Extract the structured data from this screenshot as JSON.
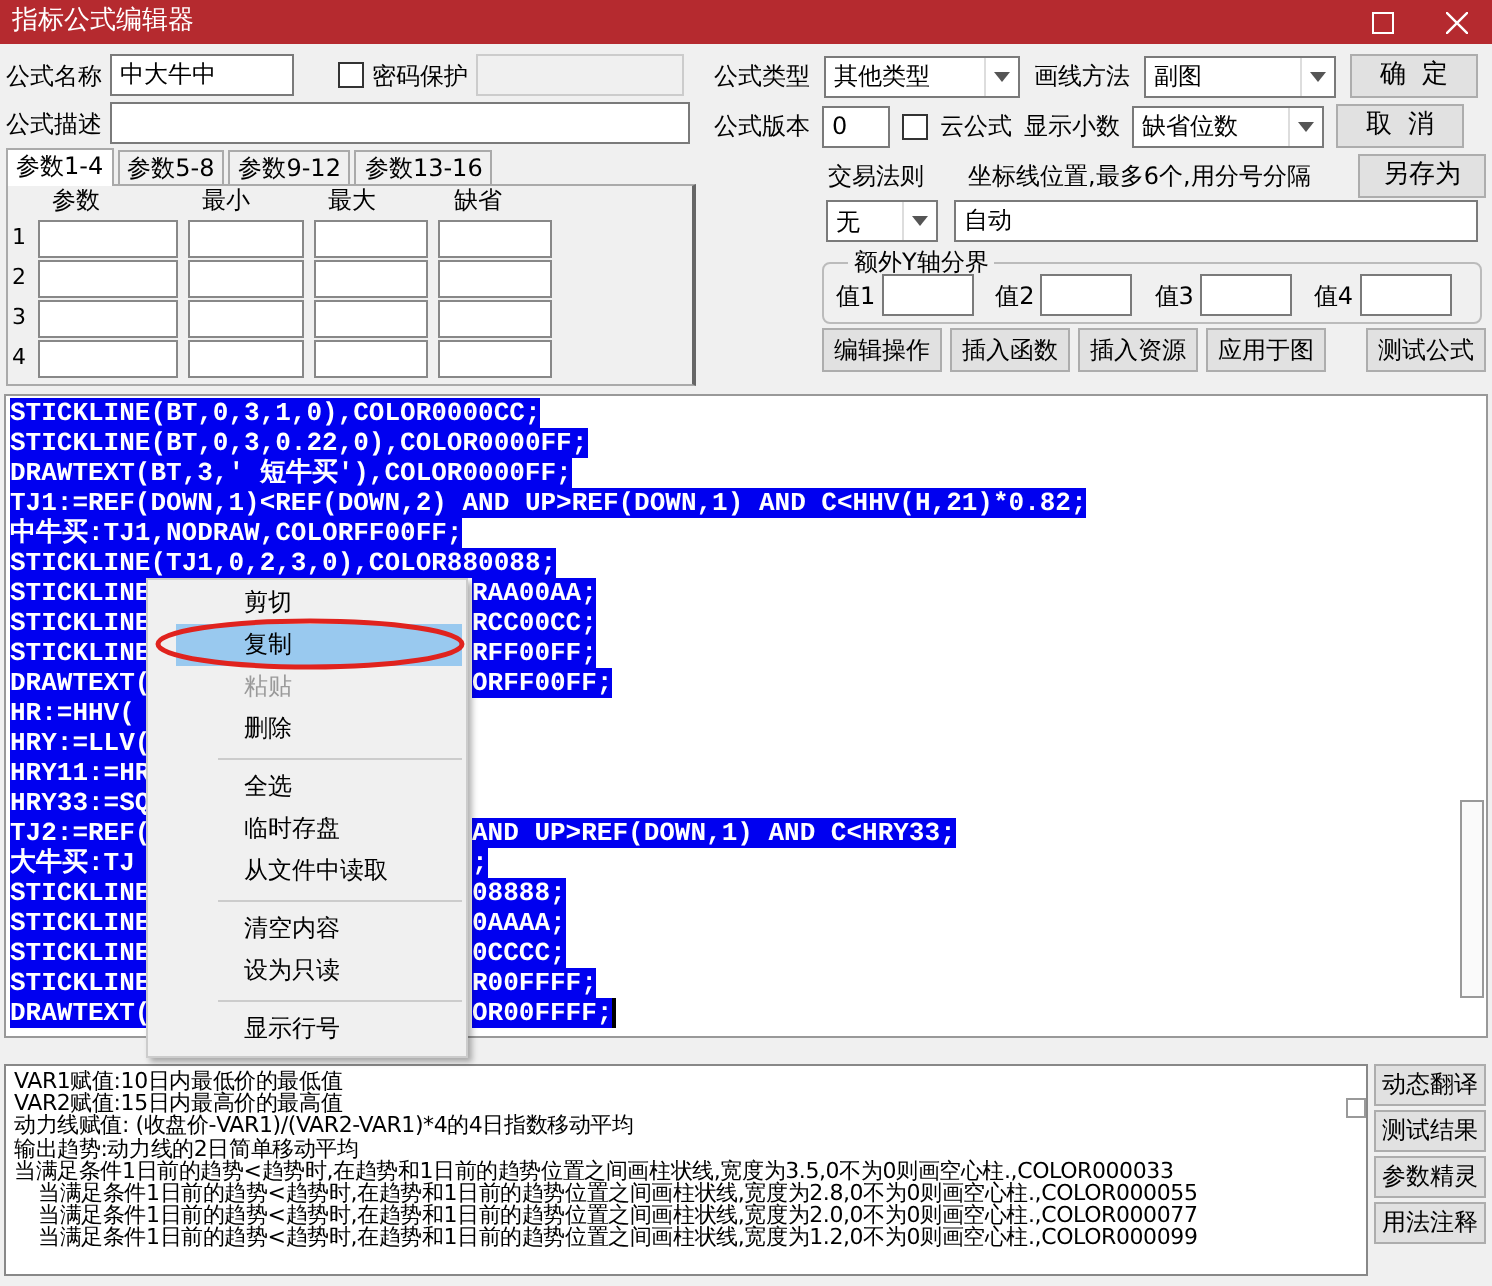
{
  "window": {
    "title": "指标公式编辑器"
  },
  "form": {
    "name": {
      "label": "公式名称",
      "value": "中大牛中"
    },
    "password": {
      "label": "密码保护",
      "checked": false
    },
    "description": {
      "label": "公式描述"
    },
    "type": {
      "label": "公式类型",
      "value": "其他类型"
    },
    "draw_method": {
      "label": "画线方法",
      "value": "副图"
    },
    "version": {
      "label": "公式版本",
      "value": "0"
    },
    "cloud": {
      "label": "云公式",
      "checked": false
    },
    "decimals": {
      "label": "显示小数",
      "value": "缺省位数"
    },
    "trade_rule": {
      "label": "交易法则",
      "value": "无"
    },
    "axis_lines": {
      "label": "坐标线位置,最多6个,用分号分隔",
      "value": "自动"
    },
    "y_bounds": {
      "title": "额外Y轴分界",
      "fields": [
        "值1",
        "值2",
        "值3",
        "值4"
      ]
    }
  },
  "dialog_buttons": [
    "确  定",
    "取  消",
    "另存为"
  ],
  "param_tabs": [
    {
      "label": "参数1-4",
      "selected": true
    },
    {
      "label": "参数5-8",
      "selected": false
    },
    {
      "label": "参数9-12",
      "selected": false
    },
    {
      "label": "参数13-16",
      "selected": false
    }
  ],
  "param_columns": [
    "参数",
    "最小",
    "最大",
    "缺省"
  ],
  "param_rows": [
    "1",
    "2",
    "3",
    "4"
  ],
  "action_buttons": [
    "编辑操作",
    "插入函数",
    "插入资源",
    "应用于图",
    "测试公式"
  ],
  "editor_lines": [
    {
      "kind": "full",
      "text": "STICKLINE(BT,0,3,1,0),COLOR0000CC;"
    },
    {
      "kind": "full",
      "text": "STICKLINE(BT,0,3,0.22,0),COLOR0000FF;"
    },
    {
      "kind": "full",
      "text": "DRAWTEXT(BT,3,' 短牛买'),COLOR0000FF;"
    },
    {
      "kind": "full",
      "text": "TJ1:=REF(DOWN,1)<REF(DOWN,2) AND UP>REF(DOWN,1) AND C<HHV(H,21)*0.82;"
    },
    {
      "kind": "full",
      "text": "中牛买:TJ1,NODRAW,COLORFF00FF;"
    },
    {
      "kind": "full",
      "text": "STICKLINE(TJ1,0,2,3,0),COLOR880088;"
    },
    {
      "kind": "split",
      "left": "STICKLINE",
      "right": "RAA00AA;"
    },
    {
      "kind": "split",
      "left": "STICKLINE",
      "right": "RCC00CC;"
    },
    {
      "kind": "split",
      "left": "STICKLINE",
      "right": "RFF00FF;"
    },
    {
      "kind": "split",
      "left": "DRAWTEXT(",
      "right": "ORFF00FF;"
    },
    {
      "kind": "split",
      "left": "HR:=HHV("
    },
    {
      "kind": "split",
      "left": "HRY:=LLV("
    },
    {
      "kind": "split",
      "left": "HRY11:=HR"
    },
    {
      "kind": "split",
      "left": "HRY33:=SQ"
    },
    {
      "kind": "split",
      "left": "TJ2:=REF(",
      "right": "AND UP>REF(DOWN,1) AND C<HRY33;"
    },
    {
      "kind": "split",
      "left": "大牛买:TJ",
      "right": ";"
    },
    {
      "kind": "split",
      "left": "STICKLINE",
      "right": "08888;"
    },
    {
      "kind": "split",
      "left": "STICKLINE",
      "right": "0AAAA;"
    },
    {
      "kind": "split",
      "left": "STICKLINE",
      "right": "0CCCC;"
    },
    {
      "kind": "split",
      "left": "STICKLINE",
      "right": "R00FFFF;"
    },
    {
      "kind": "split",
      "left": "DRAWTEXT(",
      "right": "OR00FFFF;"
    }
  ],
  "context_menu": [
    {
      "kind": "item",
      "label": "剪切",
      "selected": false,
      "disabled": false
    },
    {
      "kind": "item",
      "label": "复制",
      "selected": true,
      "disabled": false
    },
    {
      "kind": "item",
      "label": "粘贴",
      "selected": false,
      "disabled": true
    },
    {
      "kind": "item",
      "label": "删除",
      "selected": false,
      "disabled": false
    },
    {
      "kind": "separator"
    },
    {
      "kind": "item",
      "label": "全选",
      "selected": false,
      "disabled": false
    },
    {
      "kind": "item",
      "label": "临时存盘",
      "selected": false,
      "disabled": false
    },
    {
      "kind": "item",
      "label": "从文件中读取",
      "selected": false,
      "disabled": false
    },
    {
      "kind": "separator"
    },
    {
      "kind": "item",
      "label": "清空内容",
      "selected": false,
      "disabled": false
    },
    {
      "kind": "item",
      "label": "设为只读",
      "selected": false,
      "disabled": false
    },
    {
      "kind": "separator"
    },
    {
      "kind": "item",
      "label": "显示行号",
      "selected": false,
      "disabled": false
    }
  ],
  "notes": [
    {
      "text": "VAR1赋值:10日内最低价的最低值",
      "indent": false
    },
    {
      "text": "VAR2赋值:15日内最高价的最高值",
      "indent": false
    },
    {
      "text": "动力线赋值: (收盘价-VAR1)/(VAR2-VAR1)*4的4日指数移动平均",
      "indent": false
    },
    {
      "text": "输出趋势:动力线的2日简单移动平均",
      "indent": false
    },
    {
      "text": "当满足条件1日前的趋势<趋势时,在趋势和1日前的趋势位置之间画柱状线,宽度为3.5,0不为0则画空心柱.,COLOR000033",
      "indent": false
    },
    {
      "text": "当满足条件1日前的趋势<趋势时,在趋势和1日前的趋势位置之间画柱状线,宽度为2.8,0不为0则画空心柱.,COLOR000055",
      "indent": true
    },
    {
      "text": "当满足条件1日前的趋势<趋势时,在趋势和1日前的趋势位置之间画柱状线,宽度为2.0,0不为0则画空心柱.,COLOR000077",
      "indent": true
    },
    {
      "text": "当满足条件1日前的趋势<趋势时,在趋势和1日前的趋势位置之间画柱状线,宽度为1.2,0不为0则画空心柱.,COLOR000099",
      "indent": true
    }
  ],
  "side_buttons": [
    "动态翻译",
    "测试结果",
    "参数精灵",
    "用法注释"
  ]
}
